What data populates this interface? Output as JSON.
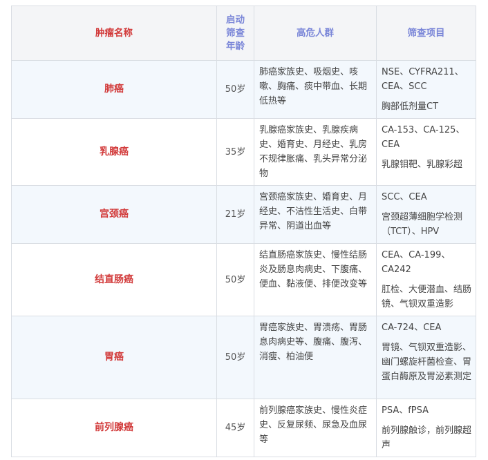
{
  "headers": {
    "name": "肿瘤名称",
    "age_lines": [
      "启动",
      "筛查",
      "年龄"
    ],
    "risk": "高危人群",
    "items": "筛查项目"
  },
  "rows": [
    {
      "name": "肺癌",
      "age": "50岁",
      "risk": "肺癌家族史、吸烟史、咳嗽、胸痛、痰中带血、长期低热等",
      "item1": "NSE、CYFRA211、CEA、SCC",
      "item2": "胸部低剂量CT"
    },
    {
      "name": "乳腺癌",
      "age": "35岁",
      "risk": "乳腺癌家族史、乳腺疾病史、婚育史、月经史、乳房不规律胀痛、乳头异常分泌物",
      "item1": "CA-153、CA-125、CEA",
      "item2": "乳腺钼靶、乳腺彩超"
    },
    {
      "name": "宫颈癌",
      "age": "21岁",
      "risk": "宫颈癌家族史、婚育史、月经史、不洁性生活史、白带异常、阴道出血等",
      "item1": "SCC、CEA",
      "item2": "宫颈超薄细胞学检测（TCT）、HPV"
    },
    {
      "name": "结直肠癌",
      "age": "50岁",
      "risk": "结直肠癌家族史、慢性结肠炎及肠息肉病史、下腹痛、便血、黏液便、排便改变等",
      "item1": "CEA、CA-199、CA242",
      "item2": "肛检、大便潜血、结肠镜、气钡双重造影"
    },
    {
      "name": "胃癌",
      "age": "50岁",
      "risk": "胃癌家族史、胃溃疡、胃肠息肉病史等、腹痛、腹泻、消瘦、柏油便",
      "item1": "CA-724、CEA",
      "item2": "胃镜、气钡双重造影、幽门螺旋杆菌检查、胃蛋白酶原及胃泌素测定"
    },
    {
      "name": "前列腺癌",
      "age": "45岁",
      "risk": "前列腺癌家族史、慢性炎症史、反复尿频、尿急及血尿等",
      "item1": "PSA、fPSA",
      "item2": "前列腺触诊，前列腺超声"
    }
  ]
}
